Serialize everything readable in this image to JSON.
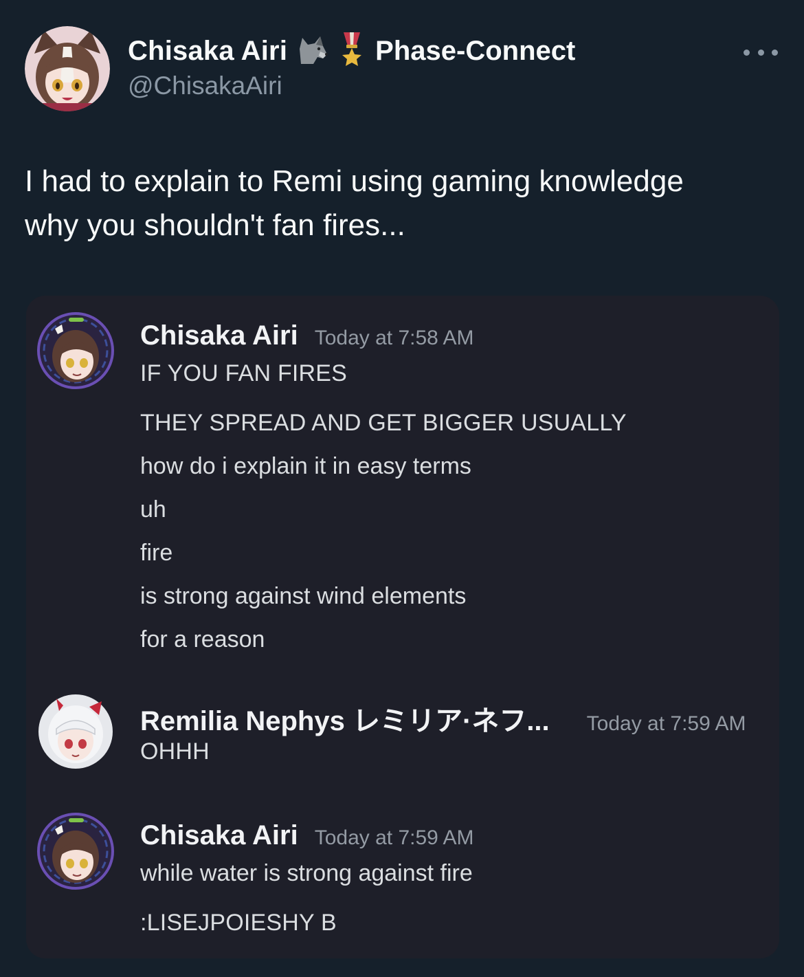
{
  "tweet": {
    "author": {
      "display_name": "Chisaka Airi",
      "handle": "@ChisakaAiri",
      "affiliation": "Phase-Connect",
      "badge_icons": [
        "wolf-icon",
        "military-medal-icon"
      ]
    },
    "more_icon": "more-options-icon",
    "text_line1": "I had to explain to Remi using gaming knowledge",
    "text_line2": "why you shouldn't fan fires..."
  },
  "discord": {
    "groups": [
      {
        "author": "Chisaka Airi",
        "timestamp": "Today at 7:58 AM",
        "lines": [
          "IF YOU FAN FIRES",
          "THEY SPREAD AND GET BIGGER USUALLY",
          "how do i explain it in easy terms",
          "uh",
          "fire",
          "is strong against wind elements",
          "for a reason"
        ]
      },
      {
        "author": "Remilia Nephys レミリア·ネフ...",
        "timestamp": "Today at 7:59 AM",
        "lines": [
          "OHHH"
        ]
      },
      {
        "author": "Chisaka Airi",
        "timestamp": "Today at 7:59 AM",
        "lines": [
          "while water is strong against fire",
          ":LISEJPOIESHY B"
        ]
      }
    ]
  },
  "colors": {
    "background": "#15202b",
    "discord_background": "#1e1f29",
    "secondary_text": "#8b98a5",
    "timestamp_text": "#949ba4",
    "avatar_ring_airi": "#6a4fb3",
    "avatar_ring_remi": "#cfd3da"
  }
}
